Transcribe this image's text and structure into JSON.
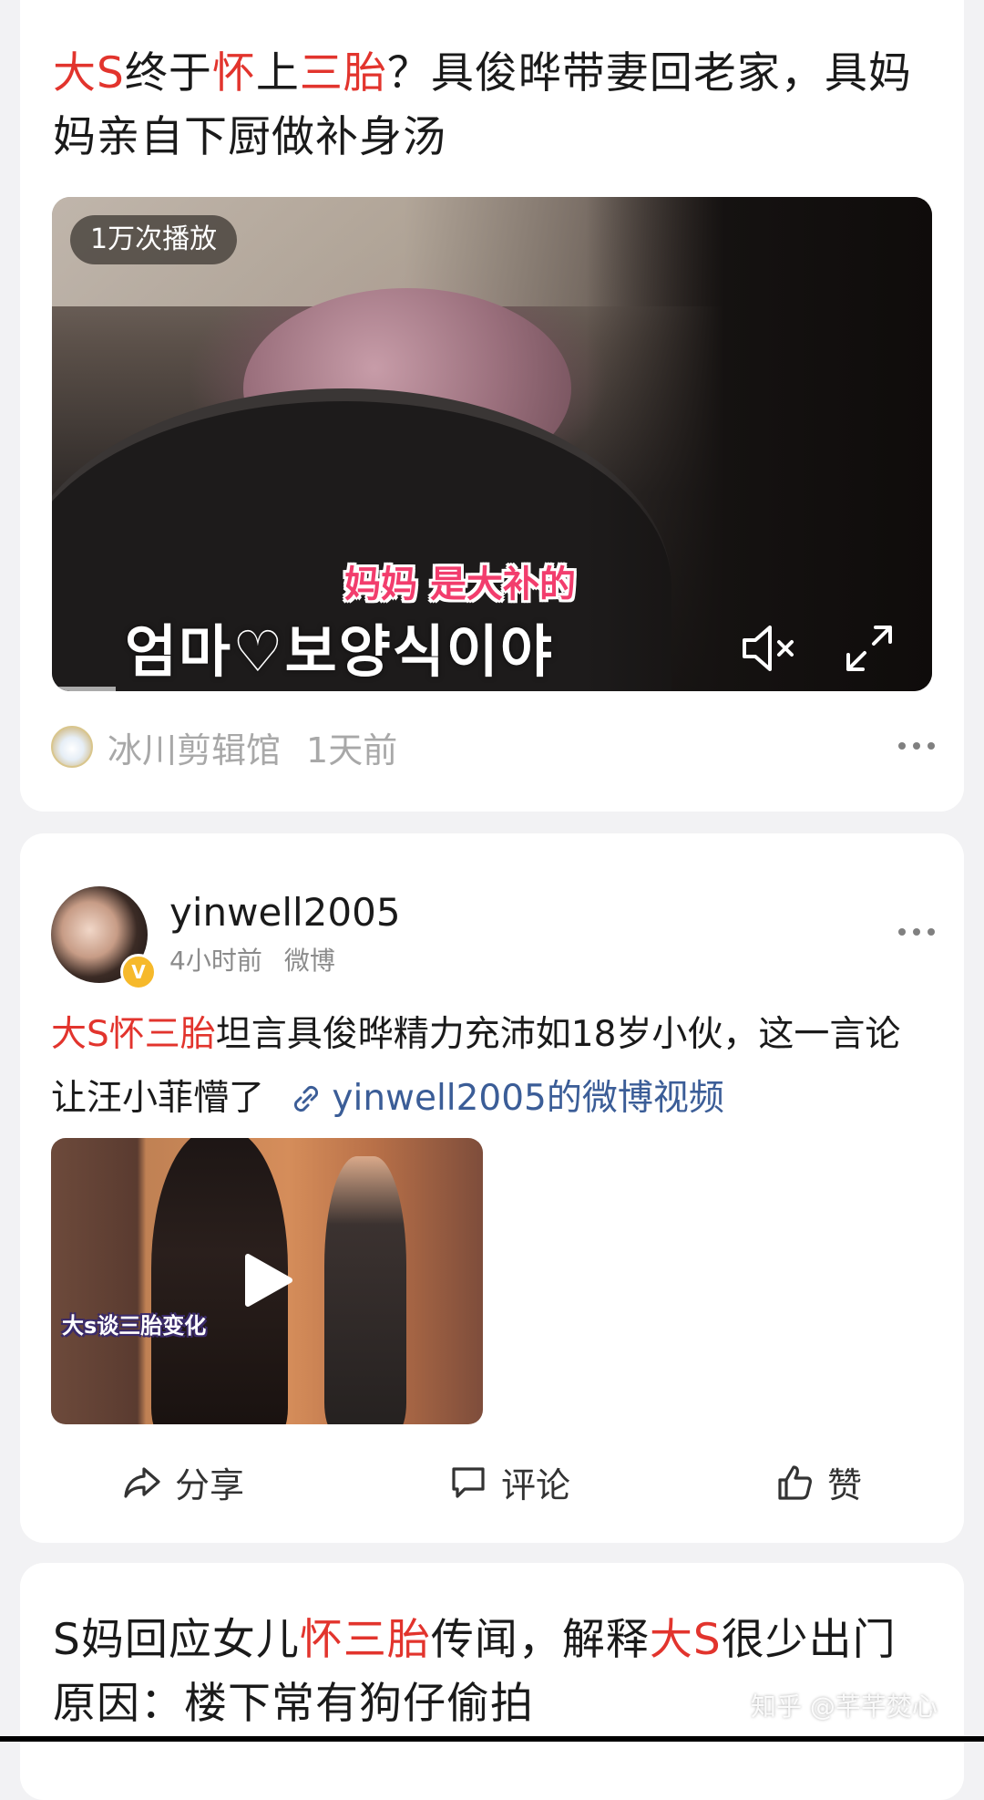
{
  "card1": {
    "title_parts": [
      {
        "text": "大S",
        "highlight": true
      },
      {
        "text": "终于",
        "highlight": false
      },
      {
        "text": "怀",
        "highlight": true
      },
      {
        "text": "上",
        "highlight": false
      },
      {
        "text": "三胎",
        "highlight": true
      },
      {
        "text": "？具俊晔带妻回老家，具妈妈亲自下厨做补身汤",
        "highlight": false
      }
    ],
    "video": {
      "play_count": "1万次播放",
      "subtitle_cn": "妈妈 是大补的",
      "subtitle_kr": "엄마♡보양식이야",
      "muted": true
    },
    "author": "冰川剪辑馆",
    "time": "1天前"
  },
  "card2": {
    "username": "yinwell2005",
    "time": "4小时前",
    "source": "微博",
    "text_highlight": "大S怀三胎",
    "text_body": "坦言具俊晔精力充沛如18岁小伙，这一言论让汪小菲懵了",
    "link_text": "yinwell2005的微博视频",
    "thumb_caption": "大s谈三胎变化",
    "actions": {
      "share": "分享",
      "comment": "评论",
      "like": "赞"
    }
  },
  "card3": {
    "title_parts": [
      {
        "text": "S妈回应女儿",
        "highlight": false
      },
      {
        "text": "怀三胎",
        "highlight": true
      },
      {
        "text": "传闻，解释",
        "highlight": false
      },
      {
        "text": "大S",
        "highlight": true
      },
      {
        "text": "很少出门原因：楼下常有狗仔偷拍",
        "highlight": false
      }
    ]
  },
  "watermark": "知乎 @芊芊焚心",
  "colors": {
    "highlight": "#e2342d",
    "link": "#3b5d97",
    "background": "#f2f2f4",
    "card": "#ffffff"
  }
}
